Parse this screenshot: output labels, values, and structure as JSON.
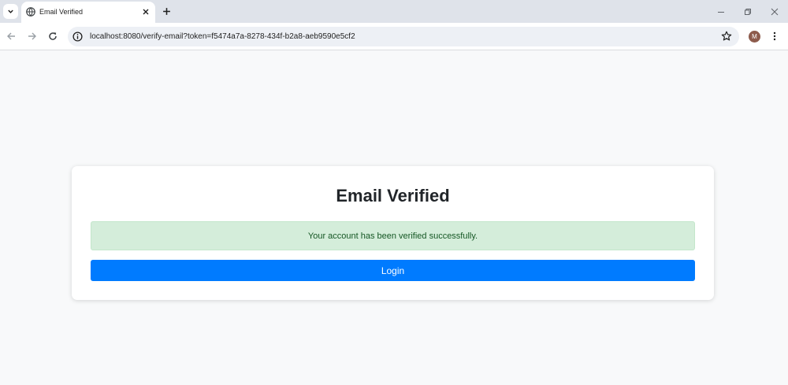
{
  "browser": {
    "tab": {
      "title": "Email Verified"
    },
    "url": "localhost:8080/verify-email?token=f5474a7a-8278-434f-b2a8-aeb9590e5cf2",
    "profile_initial": "M"
  },
  "page": {
    "heading": "Email Verified",
    "alert_message": "Your account has been verified successfully.",
    "login_label": "Login"
  },
  "colors": {
    "accent": "#007bff",
    "alert_bg": "#d4edda",
    "alert_text": "#155724",
    "page_bg": "#f8f9fa"
  }
}
